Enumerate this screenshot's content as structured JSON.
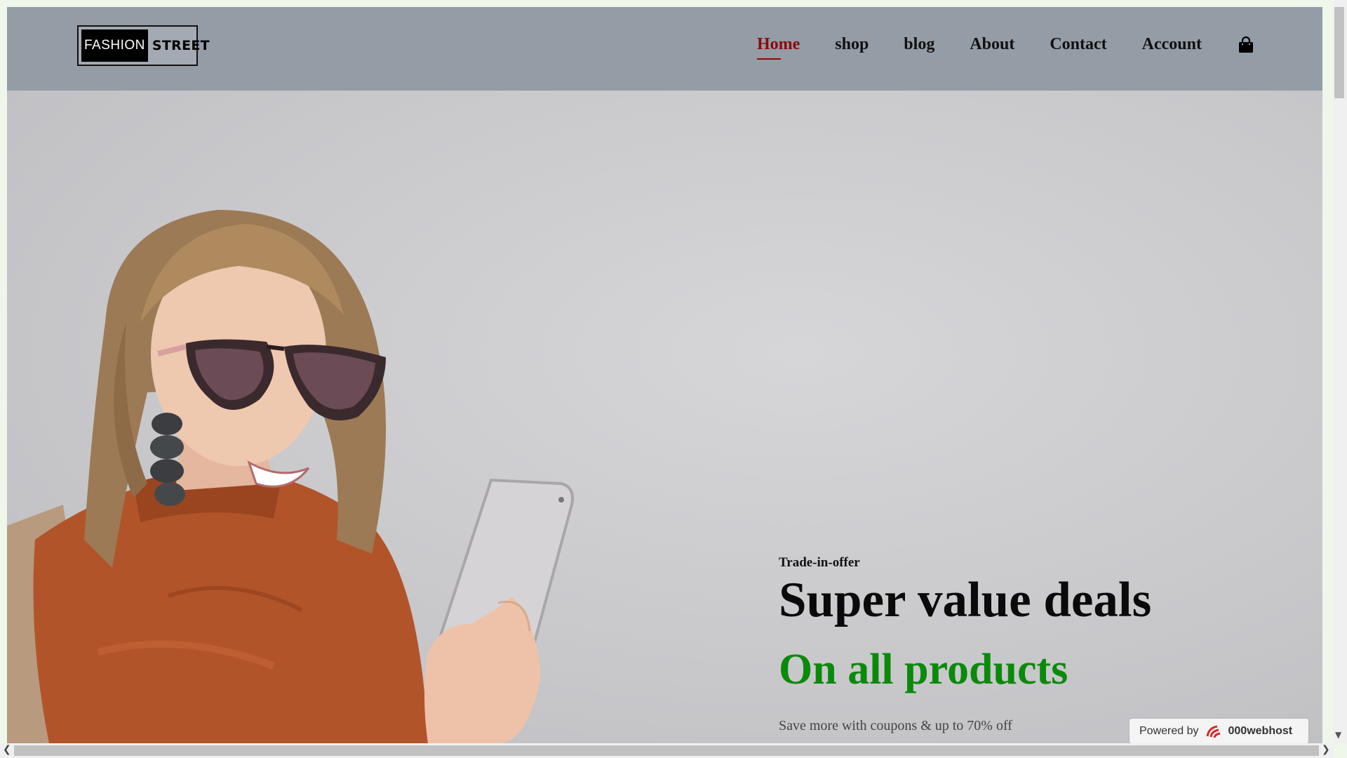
{
  "logo": {
    "left_text": "FASHION",
    "right_text": "STREET"
  },
  "nav": {
    "items": [
      {
        "label": "Home",
        "active": true
      },
      {
        "label": "shop",
        "active": false
      },
      {
        "label": "blog",
        "active": false
      },
      {
        "label": "About",
        "active": false
      },
      {
        "label": "Contact",
        "active": false
      },
      {
        "label": "Account",
        "active": false
      }
    ],
    "cart_icon": "shopping-bag-icon"
  },
  "hero": {
    "tagline": "Trade-in-offer",
    "headline": "Super value deals",
    "subheadline": "On all products",
    "caption": "Save more with coupons & up to 70% off"
  },
  "badge": {
    "prefix": "Powered by",
    "brand": "000webhost"
  },
  "colors": {
    "header_bg": "#949ca6",
    "active_nav": "#8b0a0a",
    "subheadline": "#0a8a0a",
    "hero_bg": "#cfd0d3"
  }
}
